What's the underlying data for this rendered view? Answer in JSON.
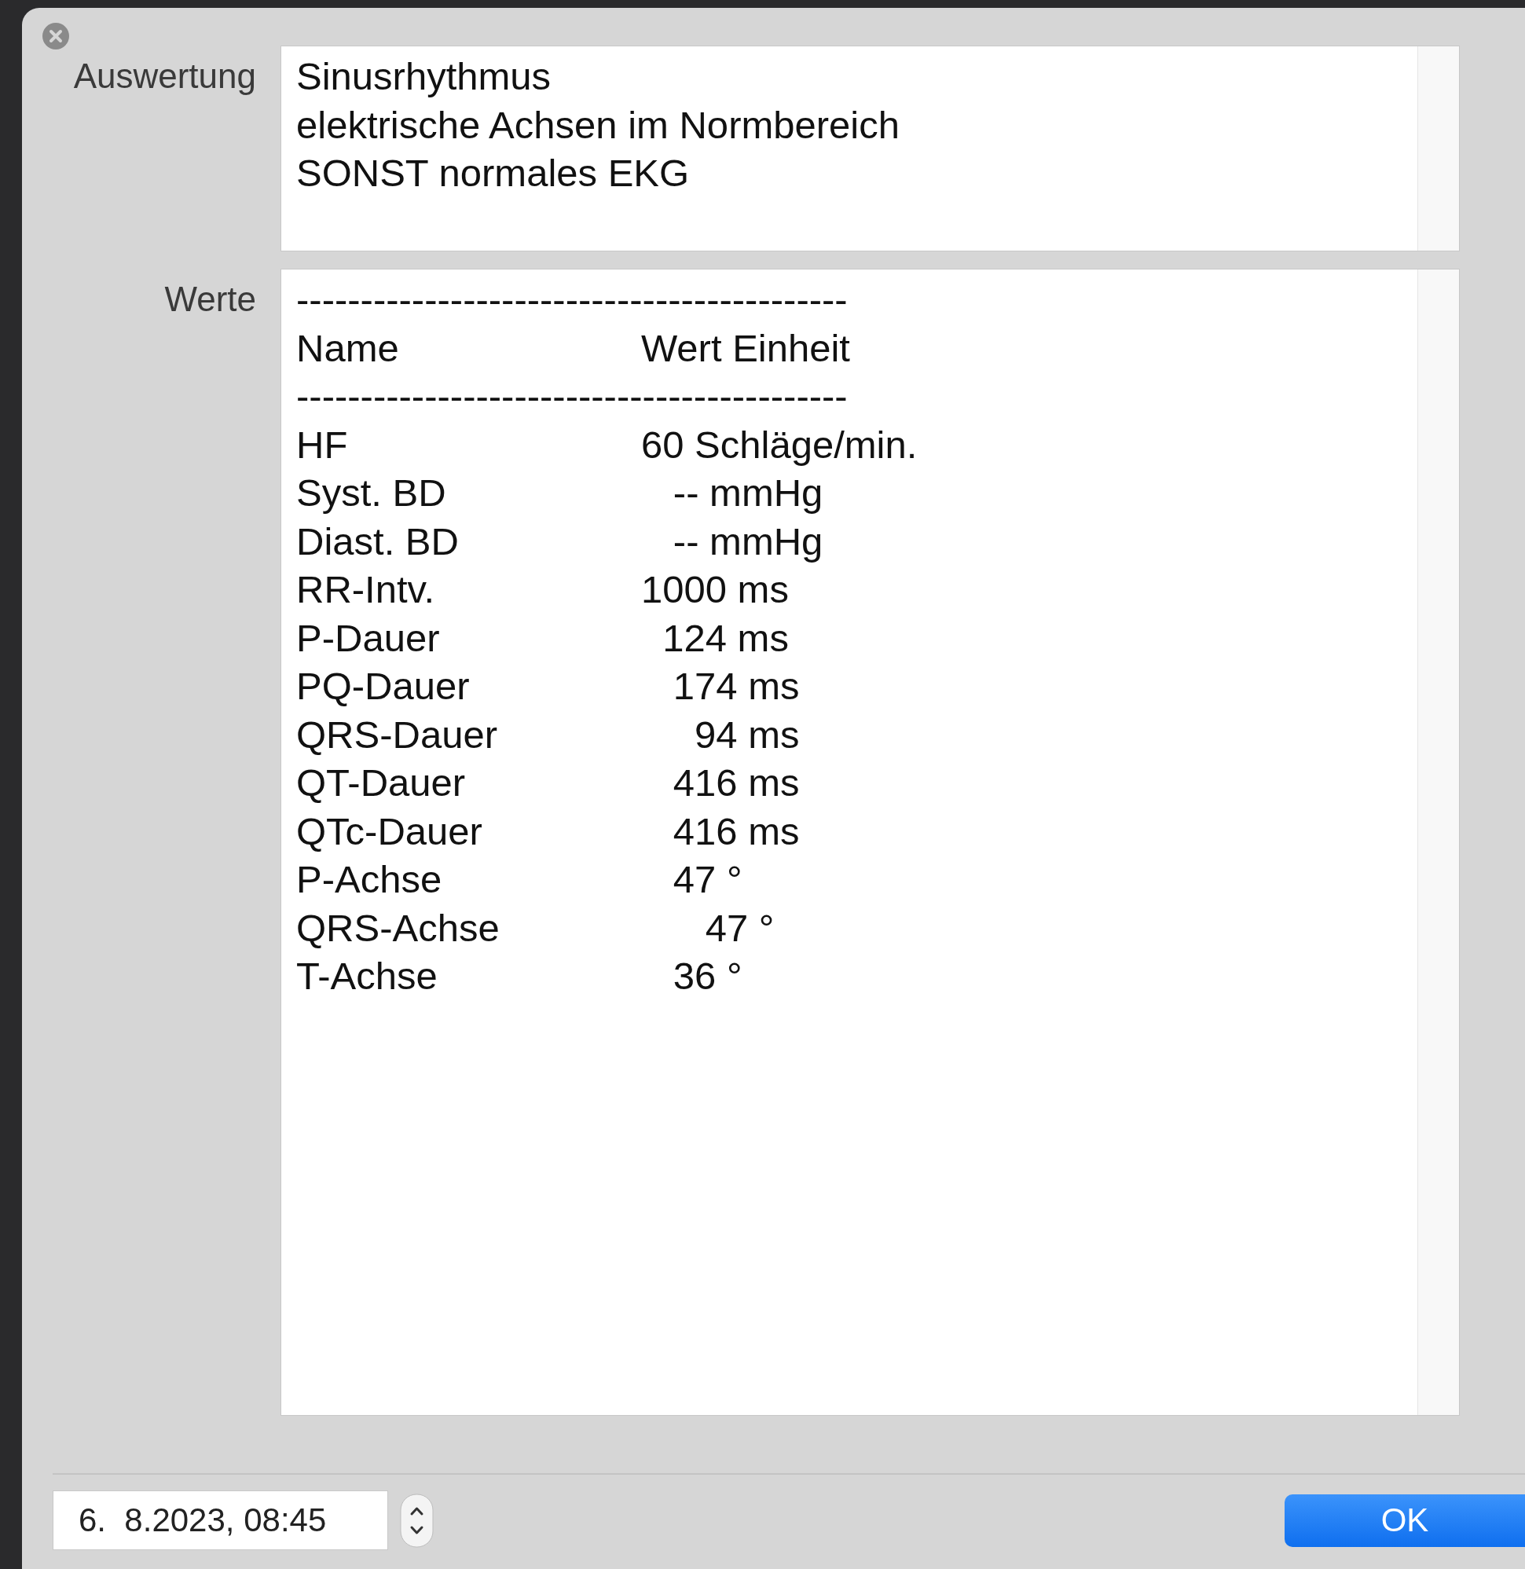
{
  "evaluation": {
    "label": "Auswertung",
    "lines": [
      "Sinusrhythmus",
      "elektrische Achsen im Normbereich",
      "SONST normales EKG"
    ]
  },
  "values": {
    "label": "Werte",
    "lines": [
      {
        "kind": "rule",
        "text": "-------------------------------------------"
      },
      {
        "kind": "row",
        "name": "Name",
        "value": "Wert Einheit"
      },
      {
        "kind": "rule",
        "text": "-------------------------------------------"
      },
      {
        "kind": "row",
        "name": "HF",
        "value": "60 Schläge/min."
      },
      {
        "kind": "row",
        "name": "Syst. BD",
        "value": "   -- mmHg"
      },
      {
        "kind": "row",
        "name": "Diast. BD",
        "value": "   -- mmHg"
      },
      {
        "kind": "row",
        "name": "RR-Intv.",
        "value": "1000 ms"
      },
      {
        "kind": "row",
        "name": "P-Dauer",
        "value": "  124 ms"
      },
      {
        "kind": "row",
        "name": "PQ-Dauer",
        "value": "   174 ms"
      },
      {
        "kind": "row",
        "name": "QRS-Dauer",
        "value": "     94 ms"
      },
      {
        "kind": "row",
        "name": "QT-Dauer",
        "value": "   416 ms"
      },
      {
        "kind": "row",
        "name": "QTc-Dauer",
        "value": "   416 ms"
      },
      {
        "kind": "row",
        "name": "P-Achse",
        "value": "   47 °"
      },
      {
        "kind": "row",
        "name": "QRS-Achse",
        "value": "      47 °"
      },
      {
        "kind": "row",
        "name": "T-Achse",
        "value": "   36 °"
      }
    ]
  },
  "footer": {
    "date_field": "6.  8.2023, 08:45",
    "ok_button": "OK"
  }
}
